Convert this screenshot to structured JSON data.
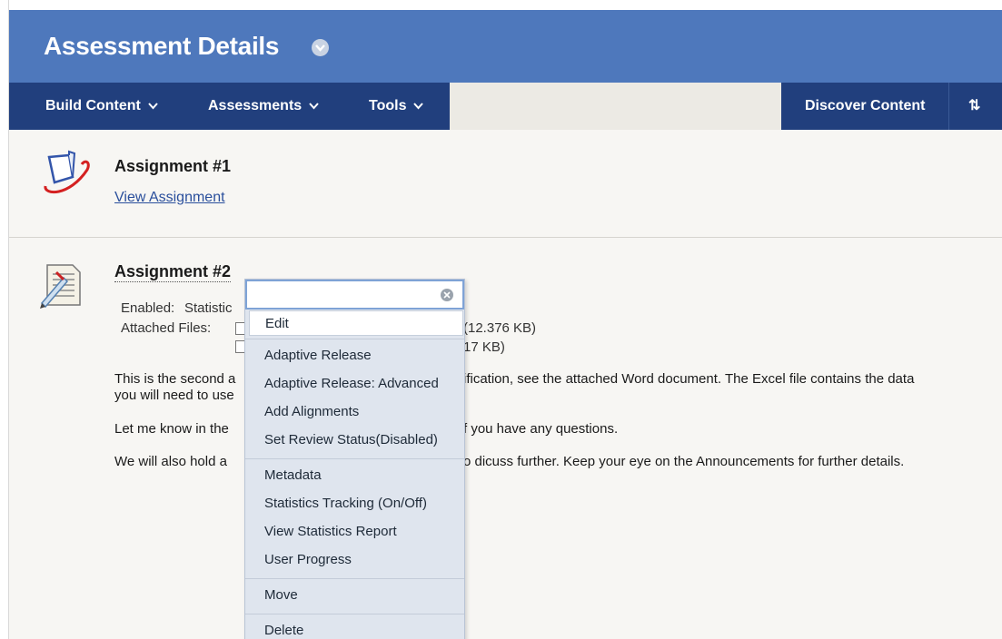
{
  "header": {
    "title": "Assessment Details"
  },
  "nav": {
    "build_content": "Build Content",
    "assessments": "Assessments",
    "tools": "Tools",
    "discover_content": "Discover Content",
    "reorder_glyph": "⇅"
  },
  "items": [
    {
      "title": "Assignment #1",
      "link": "View Assignment",
      "icon": "assignment-icon"
    },
    {
      "title": "Assignment #2",
      "icon": "test-pencil-icon",
      "enabled_label": "Enabled:",
      "enabled_value": "Statistic",
      "files_label": "Attached Files:",
      "file_sizes": [
        "(12.376 KB)",
        "17 KB)"
      ],
      "paragraphs": [
        {
          "left": "This is the second a",
          "right": "ification, see the attached Word document.  The Excel file contains the data"
        },
        {
          "left": "you will need to use",
          "right": ""
        },
        {
          "left": "Let me know in the",
          "right": "f you have any questions."
        },
        {
          "left": "We will also hold a",
          "right": "o dicuss further.  Keep your eye on the Announcements for further details."
        }
      ]
    }
  ],
  "context_menu": {
    "search_placeholder": "",
    "items": [
      "Edit",
      "Adaptive Release",
      "Adaptive Release: Advanced",
      "Add Alignments",
      "Set Review Status(Disabled)",
      "Metadata",
      "Statistics Tracking (On/Off)",
      "View Statistics Report",
      "User Progress",
      "Move",
      "Delete"
    ]
  },
  "colors": {
    "title_bar": "#4e78bc",
    "nav_bar": "#213f7d",
    "link": "#2a4f9c",
    "menu_bg": "#dfe5ee"
  }
}
